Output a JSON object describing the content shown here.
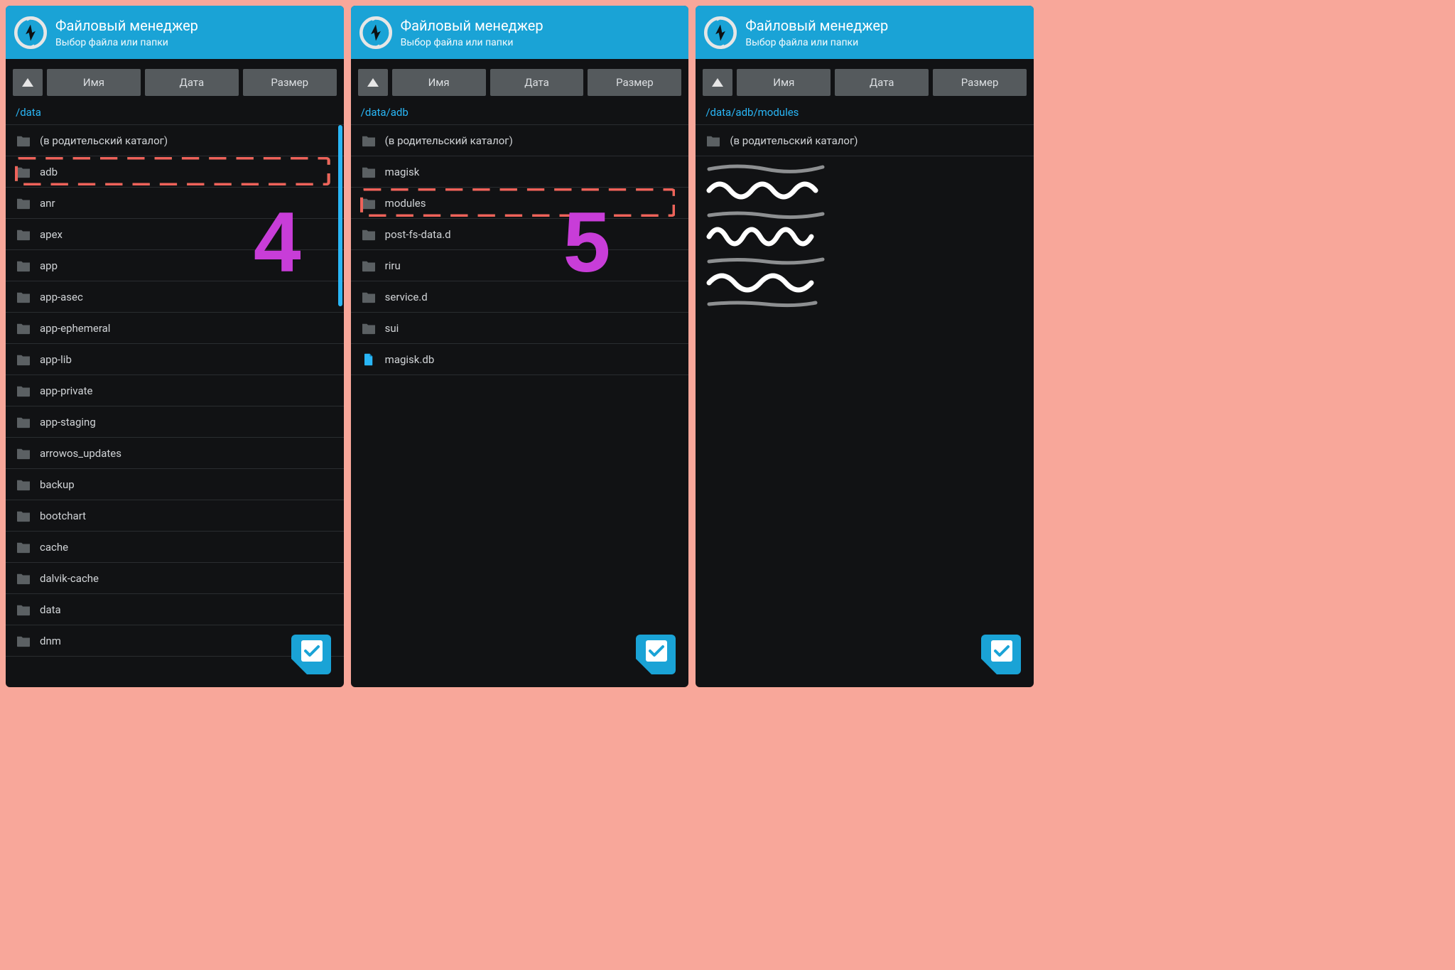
{
  "header": {
    "title": "Файловый менеджер",
    "subtitle": "Выбор файла или папки"
  },
  "sort": {
    "name": "Имя",
    "date": "Дата",
    "size": "Размер"
  },
  "panels": [
    {
      "path": "/data",
      "annot_num": "4",
      "highlight_index": 1,
      "items": [
        {
          "type": "folder",
          "label": "(в родительский каталог)"
        },
        {
          "type": "folder",
          "label": "adb"
        },
        {
          "type": "folder",
          "label": "anr"
        },
        {
          "type": "folder",
          "label": "apex"
        },
        {
          "type": "folder",
          "label": "app"
        },
        {
          "type": "folder",
          "label": "app-asec"
        },
        {
          "type": "folder",
          "label": "app-ephemeral"
        },
        {
          "type": "folder",
          "label": "app-lib"
        },
        {
          "type": "folder",
          "label": "app-private"
        },
        {
          "type": "folder",
          "label": "app-staging"
        },
        {
          "type": "folder",
          "label": "arrowos_updates"
        },
        {
          "type": "folder",
          "label": "backup"
        },
        {
          "type": "folder",
          "label": "bootchart"
        },
        {
          "type": "folder",
          "label": "cache"
        },
        {
          "type": "folder",
          "label": "dalvik-cache"
        },
        {
          "type": "folder",
          "label": "data"
        },
        {
          "type": "folder",
          "label": "dnm"
        }
      ],
      "has_scrollbar": true
    },
    {
      "path": "/data/adb",
      "annot_num": "5",
      "highlight_index": 2,
      "items": [
        {
          "type": "folder",
          "label": "(в родительский каталог)"
        },
        {
          "type": "folder",
          "label": "magisk"
        },
        {
          "type": "folder",
          "label": "modules"
        },
        {
          "type": "folder",
          "label": "post-fs-data.d"
        },
        {
          "type": "folder",
          "label": "riru"
        },
        {
          "type": "folder",
          "label": "service.d"
        },
        {
          "type": "folder",
          "label": "sui"
        },
        {
          "type": "file",
          "label": "magisk.db"
        }
      ],
      "has_scrollbar": false
    },
    {
      "path": "/data/adb/modules",
      "annot_num": null,
      "highlight_index": null,
      "items": [
        {
          "type": "folder",
          "label": "(в родительский каталог)"
        }
      ],
      "has_scrollbar": false,
      "scribbles": true
    }
  ]
}
